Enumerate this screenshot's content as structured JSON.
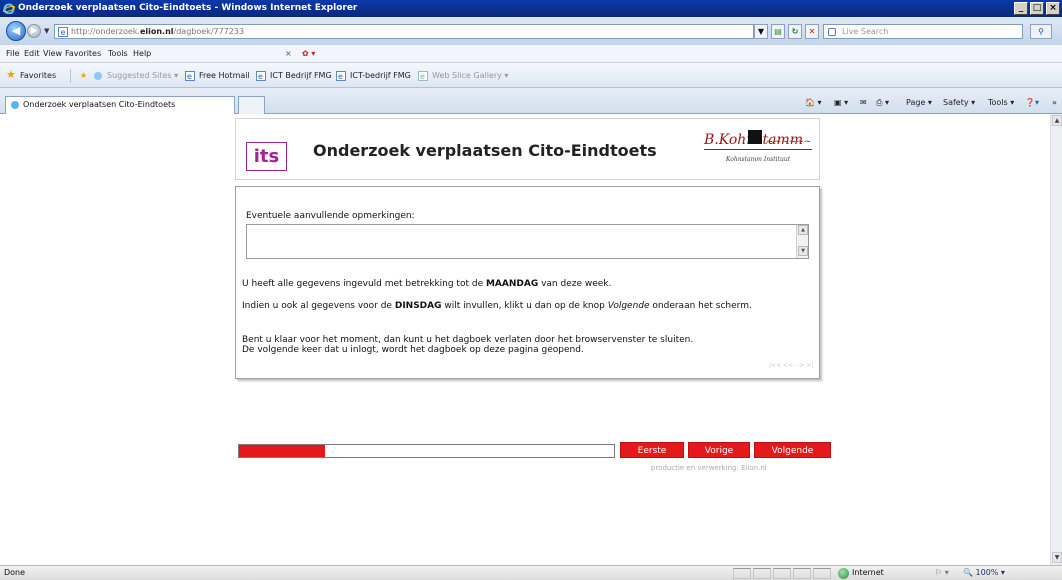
{
  "window": {
    "title": "Onderzoek verplaatsen Cito-Eindtoets - Windows Internet Explorer"
  },
  "address": {
    "url_prefix": "http://onderzoek.",
    "url_domain": "elion.nl",
    "url_path": "/dagboek/777233",
    "search_placeholder": "Live Search"
  },
  "menu": [
    "File",
    "Edit",
    "View",
    "Favorites",
    "Tools",
    "Help"
  ],
  "favorites": {
    "label": "Favorites",
    "items": [
      "Suggested Sites ▾",
      "Free Hotmail",
      "ICT Bedrijf FMG",
      "ICT-bedrijf FMG",
      "Web Slice Gallery ▾"
    ]
  },
  "tab": {
    "title": "Onderzoek verplaatsen Cito-Eindtoets"
  },
  "command_bar": {
    "page": "Page ▾",
    "safety": "Safety ▾",
    "tools": "Tools ▾"
  },
  "header": {
    "logo_text": "its",
    "title": "Onderzoek verplaatsen Cito-Eindtoets",
    "partner_caption": "Kohnstamm Instituut",
    "signature_text": "B.Kohnstamm"
  },
  "form": {
    "comments_label": "Eventuele aanvullende opmerkingen:",
    "comments_value": "",
    "line1_a": "U heeft alle gegevens ingevuld met betrekking tot de ",
    "line1_b": "MAANDAG",
    "line1_c": " van deze week.",
    "line2_a": "Indien u ook al gegevens voor de ",
    "line2_b": "DINSDAG",
    "line2_c": " wilt invullen, klikt u dan op de knop ",
    "line2_d": "Volgende",
    "line2_e": " onderaan het scherm.",
    "line3": "Bent u klaar voor het moment, dan kunt u het dagboek verlaten door het browservenster te sluiten.",
    "line4": "De volgende keer dat u inlogt, wordt het dagboek op deze pagina geopend.",
    "mini_nav": "|<< <<- -> >|"
  },
  "progress": {
    "fraction": 0.23
  },
  "nav": {
    "first": "Eerste",
    "previous": "Vorige",
    "next": "Volgende"
  },
  "credit": "productie en verwerking: Elion.nl",
  "status": {
    "text": "Done",
    "zone": "Internet",
    "zoom": "100%"
  },
  "colors": {
    "accent": "#e41a1a",
    "its": "#a6238e",
    "titlebar": "#0c3aa8"
  }
}
